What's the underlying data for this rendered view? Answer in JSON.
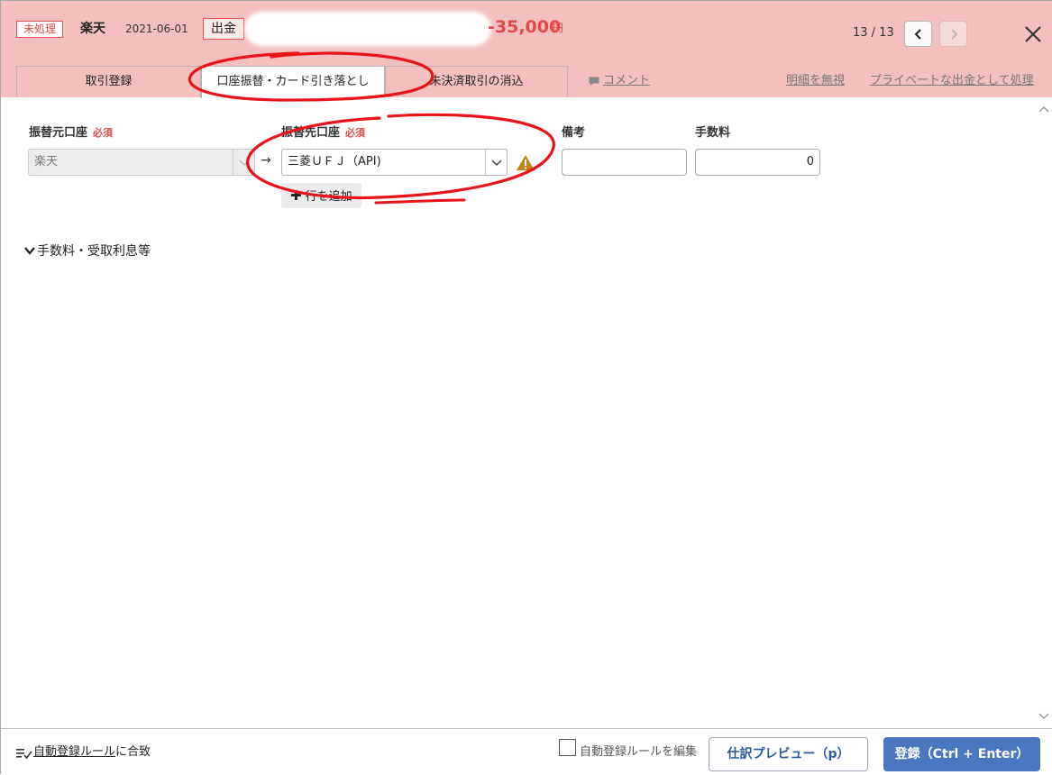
{
  "header": {
    "status_badge": "未処理",
    "account": "楽天",
    "date": "2021-06-01",
    "type_badge": "出金",
    "amount": "-35,000",
    "amount_unit": "円",
    "pager": "13 / 13",
    "prev_icon": "chevron-left-icon",
    "next_icon": "chevron-right-icon",
    "close_icon": "close-icon"
  },
  "tabs": [
    {
      "label": "取引登録",
      "active": false
    },
    {
      "label": "口座振替・カード引き落とし",
      "active": true
    },
    {
      "label": "未決済取引の消込",
      "active": false
    }
  ],
  "header_links": {
    "comment": "コメント",
    "ignore": "明細を無視",
    "private": "プライベートな出金として処理"
  },
  "form": {
    "from_account_label": "振替元口座",
    "to_account_label": "振替先口座",
    "required_label": "必須",
    "memo_label": "備考",
    "fee_label": "手数料",
    "from_account_value": "楽天",
    "to_account_value": "三菱ＵＦＪ（API)",
    "memo_value": "",
    "fee_value": "0",
    "add_row": "行を追加",
    "fees_section_toggle": "手数料・受取利息等"
  },
  "footer": {
    "rule_match_link": "自動登録ルール",
    "rule_match_suffix": "に合致",
    "edit_rule_checkbox_label": "自動登録ルールを編集",
    "edit_rule_checked": false,
    "preview_button": "仕訳プレビュー（p）",
    "register_button": "登録（Ctrl + Enter）"
  },
  "colors": {
    "header_bg": "#f4bfbf",
    "amount_red": "#e24a4a",
    "primary_blue": "#4a77c0",
    "annotation_red": "#e8141a"
  }
}
